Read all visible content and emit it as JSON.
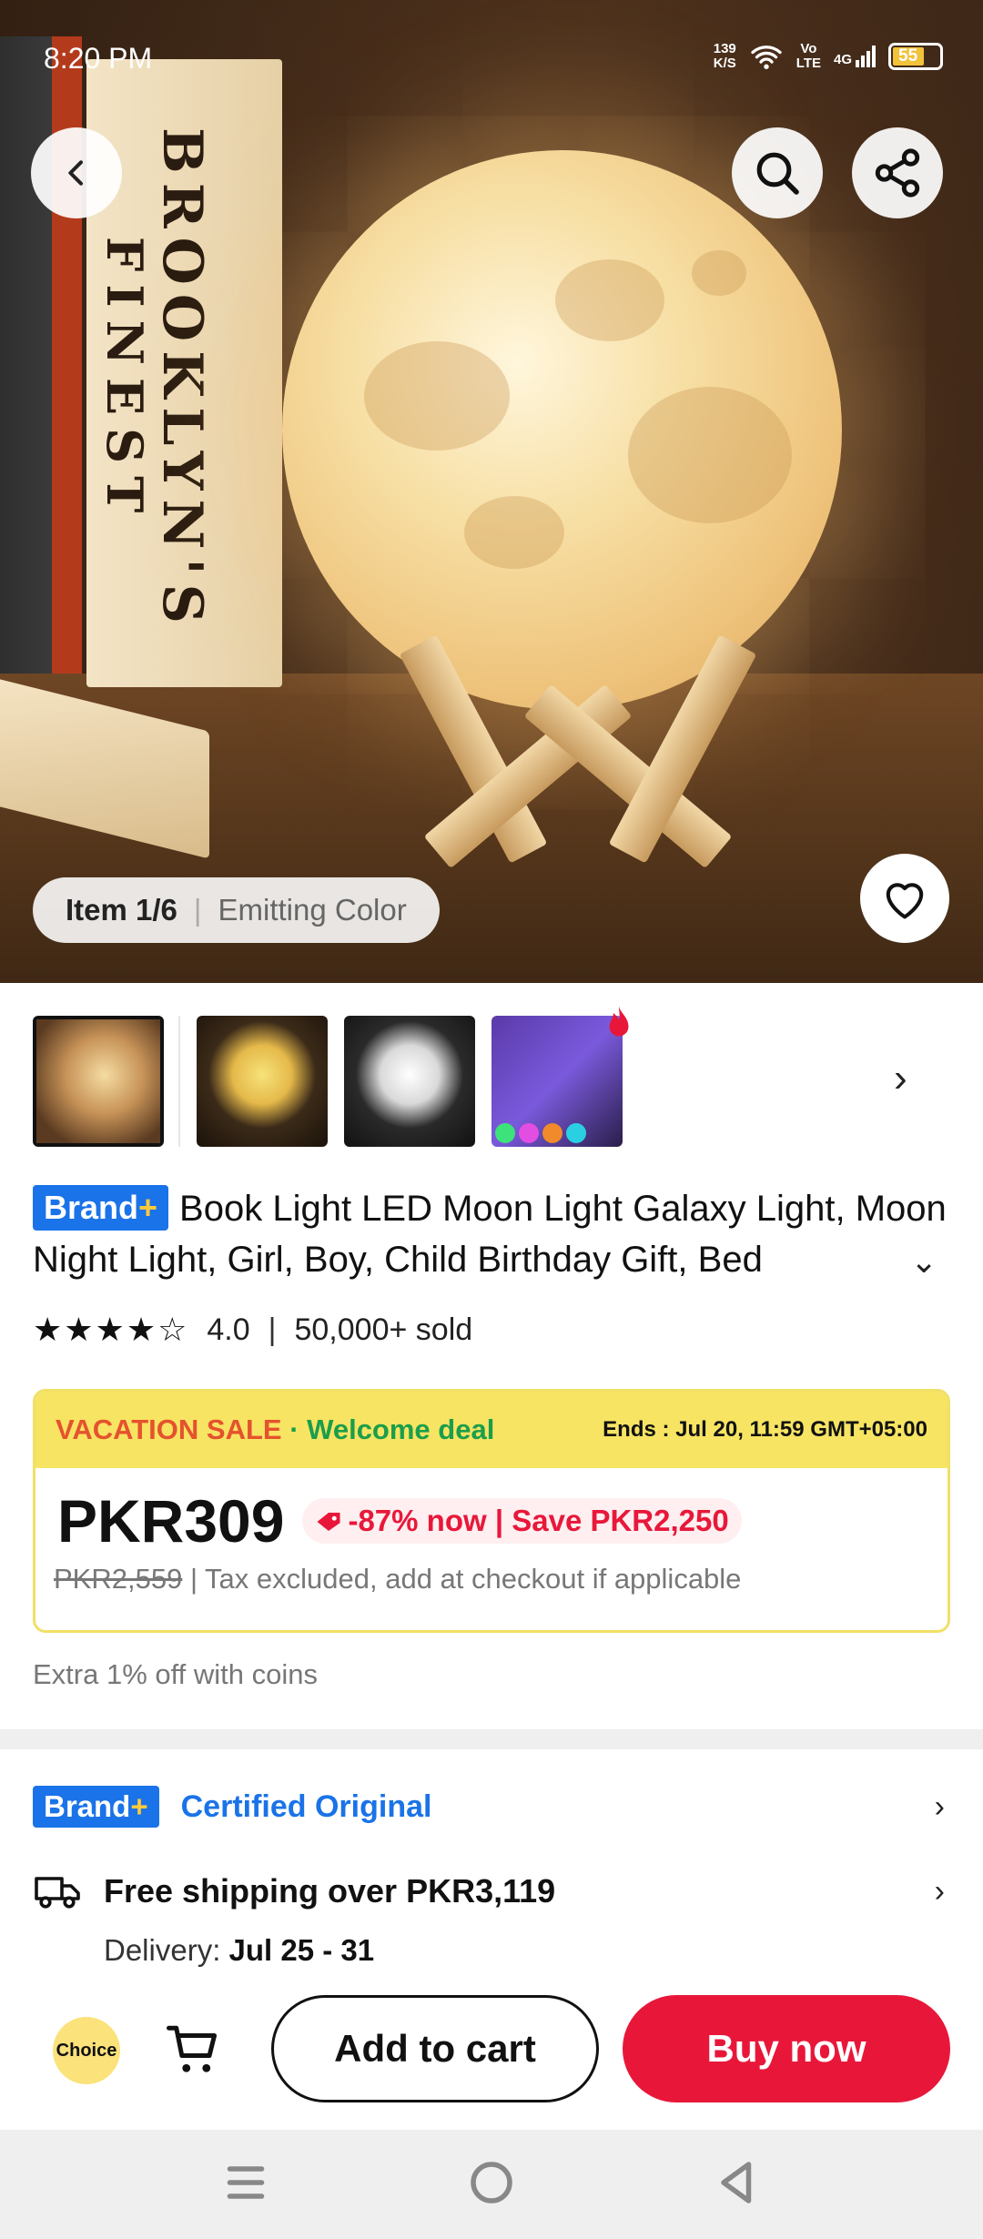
{
  "status_bar": {
    "time": "8:20 PM",
    "net_speed_top": "139",
    "net_speed_bottom": "K/S",
    "volte_top": "Vo",
    "volte_bottom": "LTE",
    "network": "4G",
    "battery": "55"
  },
  "hero": {
    "item_label": "Item 1/6",
    "variant_label": "Emitting Color",
    "book_spine_1": "BROOKLYN'S",
    "book_spine_2": "FINEST"
  },
  "thumbnails": [
    {
      "name": "moon-lamp-warm-desk",
      "selected": true
    },
    {
      "name": "moon-night-light-yellow",
      "selected": false
    },
    {
      "name": "moon-night-light-white",
      "selected": false
    },
    {
      "name": "moon-light-colors",
      "selected": false
    }
  ],
  "product": {
    "brand_badge": "Brand",
    "brand_plus": "+",
    "title": "Book Light LED Moon Light Galaxy Light, Moon Night Light, Girl, Boy, Child Birthday Gift, Bed",
    "rating_value": "4.0",
    "rating_stars": 4,
    "sold": "50,000+ sold"
  },
  "sale": {
    "event": "VACATION SALE",
    "dot": " · ",
    "deal": "Welcome deal",
    "ends": "Ends :  Jul 20, 11:59 GMT+05:00",
    "price": "PKR309",
    "discount": "-87% now | Save PKR2,250",
    "old_price": "PKR2,559",
    "tax_note": " | Tax excluded, add at checkout if applicable"
  },
  "coins_note": "Extra 1% off with coins",
  "certified": {
    "badge": "Brand",
    "badge_plus": "+",
    "text": "Certified Original"
  },
  "shipping": {
    "text": "Free shipping over PKR3,119",
    "delivery_label": "Delivery: ",
    "delivery_date": "Jul 25 - 31"
  },
  "actions": {
    "choice": "Choice",
    "add_to_cart": "Add to cart",
    "buy_now": "Buy now"
  },
  "colors": {
    "brand_blue": "#1a73e8",
    "buy_red": "#e8173a",
    "sale_yellow": "#f7e463",
    "deal_green": "#1b9e4b",
    "sale_orange": "#e5522e"
  }
}
